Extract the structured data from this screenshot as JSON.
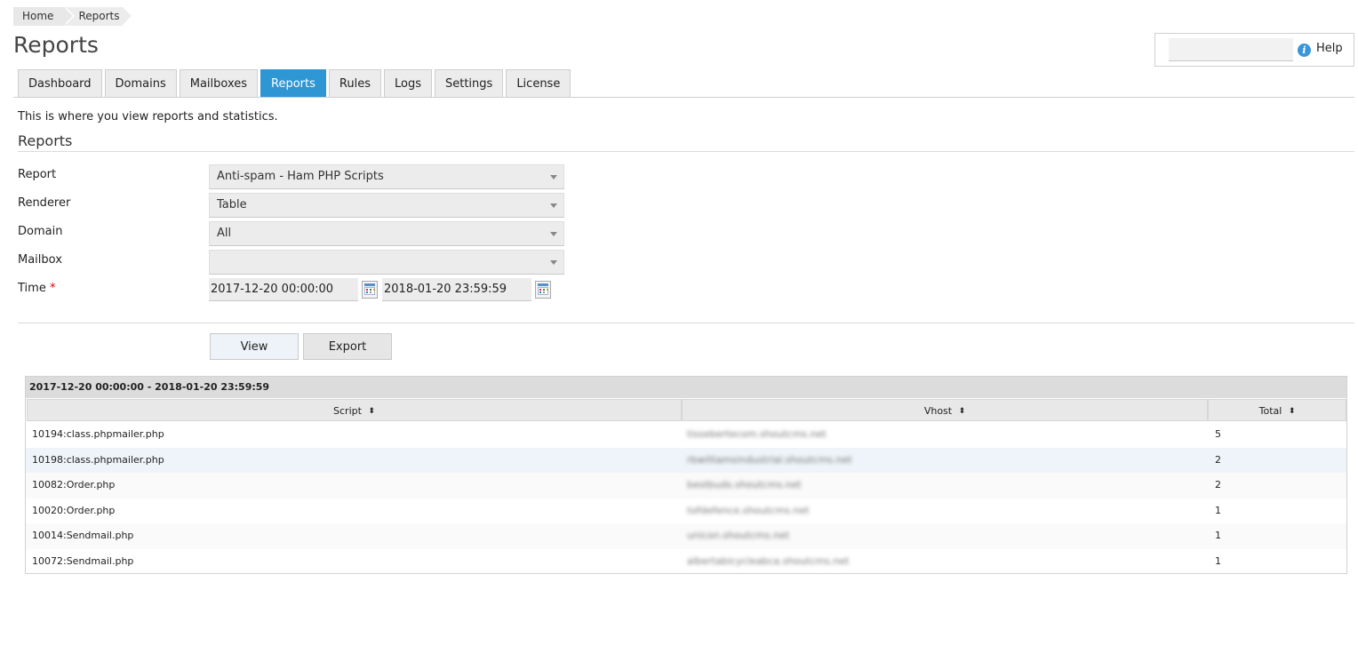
{
  "breadcrumb": {
    "items": [
      "Home",
      "Reports"
    ]
  },
  "page": {
    "title": "Reports",
    "intro": "This is where you view reports and statistics.",
    "section_title": "Reports"
  },
  "help": {
    "label": "Help",
    "input_value": ""
  },
  "tabs": [
    {
      "label": "Dashboard",
      "active": false
    },
    {
      "label": "Domains",
      "active": false
    },
    {
      "label": "Mailboxes",
      "active": false
    },
    {
      "label": "Reports",
      "active": true
    },
    {
      "label": "Rules",
      "active": false
    },
    {
      "label": "Logs",
      "active": false
    },
    {
      "label": "Settings",
      "active": false
    },
    {
      "label": "License",
      "active": false
    }
  ],
  "form": {
    "report_label": "Report",
    "report_value": "Anti-spam - Ham PHP Scripts",
    "renderer_label": "Renderer",
    "renderer_value": "Table",
    "domain_label": "Domain",
    "domain_value": "All",
    "mailbox_label": "Mailbox",
    "mailbox_value": "",
    "time_label": "Time",
    "time_required": "*",
    "time_from": "2017-12-20 00:00:00",
    "time_to": "2018-01-20 23:59:59"
  },
  "buttons": {
    "view": "View",
    "export": "Export"
  },
  "table": {
    "caption": "2017-12-20 00:00:00 - 2018-01-20 23:59:59",
    "columns": {
      "script": "Script",
      "vhost": "Vhost",
      "total": "Total"
    },
    "sort_glyph": "⬍",
    "rows": [
      {
        "script": "10194:class.phpmailer.php",
        "vhost": "tissebertecom.shoutcms.net",
        "total": "5"
      },
      {
        "script": "10198:class.phpmailer.php",
        "vhost": "rbwilliamsindustrial.shoutcms.net",
        "total": "2"
      },
      {
        "script": "10082:Order.php",
        "vhost": "bestbuds.shoutcms.net",
        "total": "2"
      },
      {
        "script": "10020:Order.php",
        "vhost": "tofdefence.shoutcms.net",
        "total": "1"
      },
      {
        "script": "10014:Sendmail.php",
        "vhost": "unicon.shoutcms.net",
        "total": "1"
      },
      {
        "script": "10072:Sendmail.php",
        "vhost": "albertabicycleabca.shoutcms.net",
        "total": "1"
      }
    ]
  },
  "colors": {
    "accent": "#2f96d4",
    "tab_bg": "#ececec",
    "row_highlight": "#eef4f9"
  }
}
